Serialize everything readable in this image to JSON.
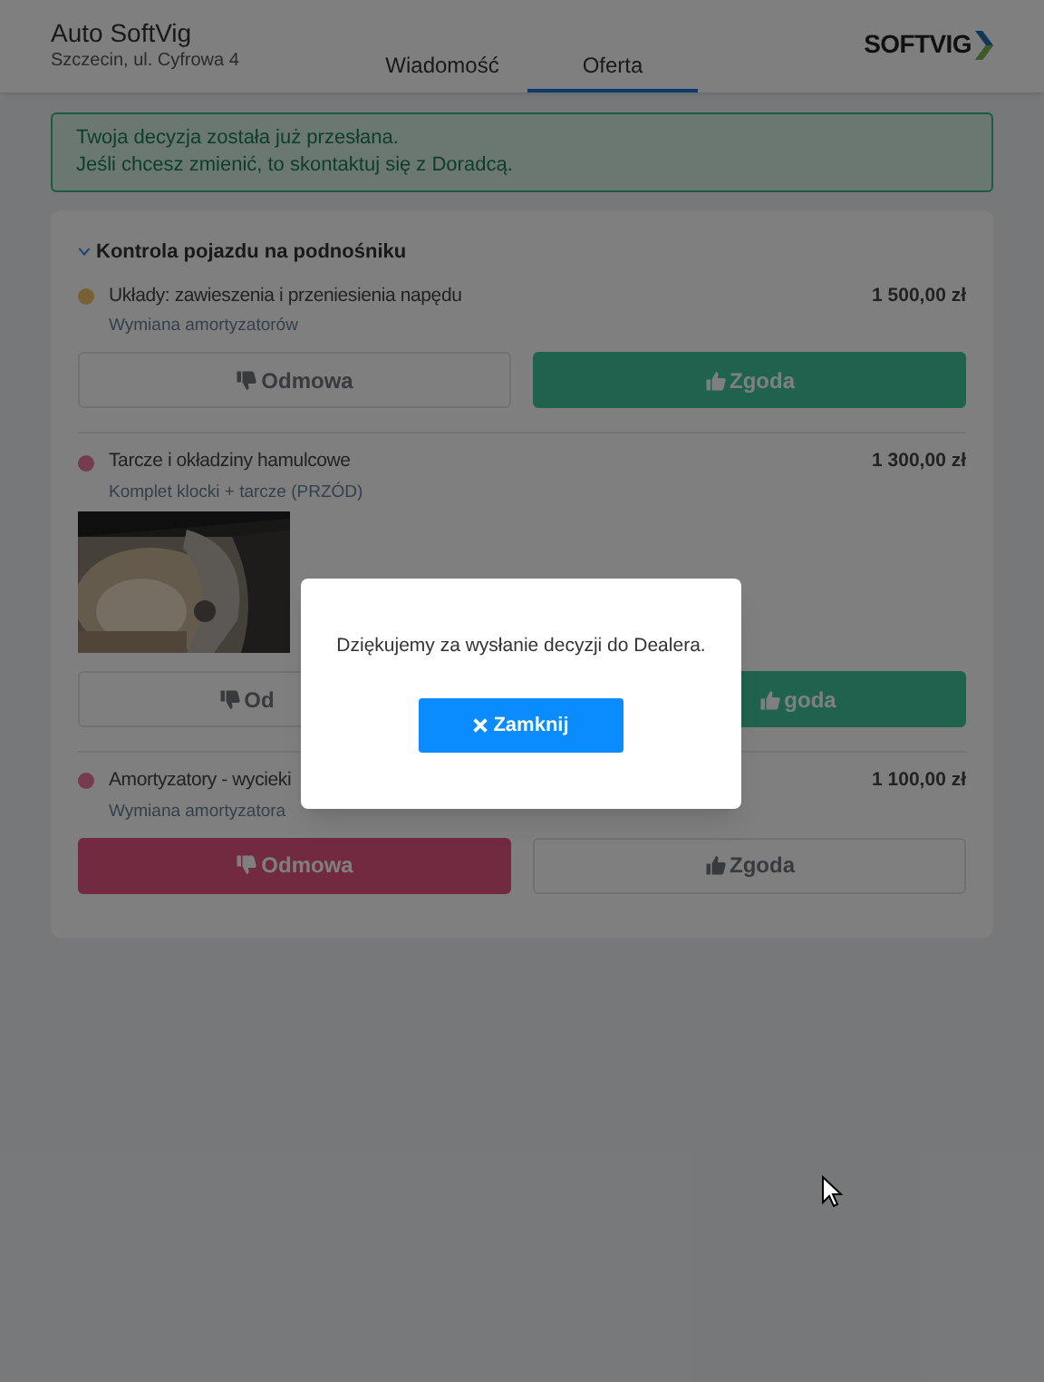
{
  "header": {
    "company": "Auto SoftVig",
    "address": "Szczecin, ul. Cyfrowa 4",
    "logo": "SOFTVIG"
  },
  "tabs": [
    {
      "label": "Wiadomość",
      "selected": false
    },
    {
      "label": "Oferta",
      "selected": true
    }
  ],
  "alert": {
    "lines": [
      "Twoja decyzja została już przesłana.",
      "Jeśli chcesz zmienić, to skontaktuj się z Doradcą."
    ]
  },
  "section": {
    "title": "Kontrola pojazdu na podnośniku",
    "expanded": true,
    "items": [
      {
        "color": "#786135",
        "title": "Układy: zawieszenia i przeniesienia napędu",
        "subtitle": "Wymiana amortyzatorów",
        "price": "1 500,00 zł",
        "refuse": {
          "label": "Odmowa",
          "selected": false
        },
        "agree": {
          "label": "Zgoda",
          "selected": true
        }
      },
      {
        "color": "#753c4d",
        "title": "Tarcze i okładziny hamulcowe",
        "subtitle": "Komplet klocki + tarcze (PRZÓD)",
        "price": "1 300,00 zł",
        "refuse": {
          "label": "Od",
          "selected": false
        },
        "agree": {
          "label": "goda",
          "selected": true
        }
      },
      {
        "color": "#753c4d",
        "title": "Amortyzatory - wycieki",
        "subtitle": "Wymiana amortyzatora",
        "price": "1 100,00 zł",
        "refuse": {
          "label": "Odmowa",
          "selected": true
        },
        "agree": {
          "label": "Zgoda",
          "selected": false
        }
      }
    ]
  },
  "modal": {
    "message": "Dziękujemy za wysłanie decyzji do Dealera.",
    "button": "Zamknij"
  }
}
